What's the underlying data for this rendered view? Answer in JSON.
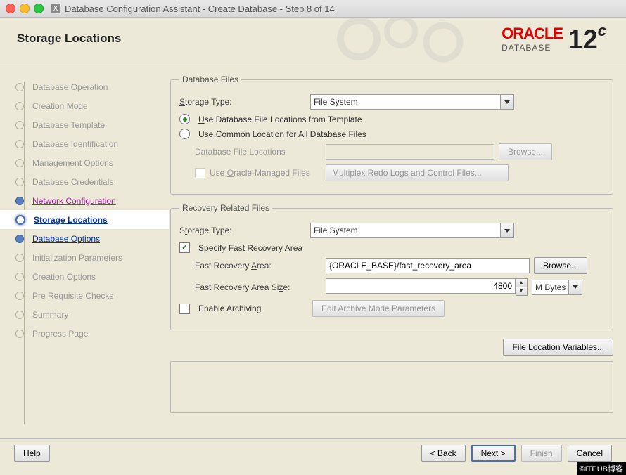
{
  "window": {
    "title": "Database Configuration Assistant - Create Database - Step 8 of 14"
  },
  "header": {
    "page_title": "Storage Locations",
    "brand_top": "ORACLE",
    "brand_sub": "DATABASE",
    "brand_ver": "12",
    "brand_c": "c"
  },
  "sidebar": {
    "items": [
      {
        "label": "Database Operation",
        "state": "done"
      },
      {
        "label": "Creation Mode",
        "state": "done"
      },
      {
        "label": "Database Template",
        "state": "done"
      },
      {
        "label": "Database Identification",
        "state": "done"
      },
      {
        "label": "Management Options",
        "state": "done"
      },
      {
        "label": "Database Credentials",
        "state": "done"
      },
      {
        "label": "Network Configuration",
        "state": "done_link"
      },
      {
        "label": "Storage Locations",
        "state": "current"
      },
      {
        "label": "Database Options",
        "state": "next"
      },
      {
        "label": "Initialization Parameters",
        "state": "todo"
      },
      {
        "label": "Creation Options",
        "state": "todo"
      },
      {
        "label": "Pre Requisite Checks",
        "state": "todo"
      },
      {
        "label": "Summary",
        "state": "todo"
      },
      {
        "label": "Progress Page",
        "state": "todo"
      }
    ]
  },
  "db_files": {
    "legend": "Database Files",
    "storage_type_label": "Storage Type:",
    "storage_type_value": "File System",
    "radio_template": "Use Database File Locations from Template",
    "radio_common": "Use Common Location for All Database Files",
    "loc_label": "Database File Locations",
    "loc_value": "",
    "browse": "Browse...",
    "omf_label": "Use Oracle-Managed Files",
    "multiplex": "Multiplex Redo Logs and Control Files..."
  },
  "recovery": {
    "legend": "Recovery Related Files",
    "storage_type_label": "Storage Type:",
    "storage_type_value": "File System",
    "specify_label": "Specify Fast Recovery Area",
    "fra_label": "Fast Recovery Area:",
    "fra_value": "{ORACLE_BASE}/fast_recovery_area",
    "browse": "Browse...",
    "size_label": "Fast Recovery Area Size:",
    "size_value": "4800",
    "size_unit": "M Bytes",
    "archive_label": "Enable Archiving",
    "archive_btn": "Edit Archive Mode Parameters"
  },
  "file_loc_vars": "File Location Variables...",
  "footer": {
    "help": "Help",
    "back": "< Back",
    "next": "Next >",
    "finish": "Finish",
    "cancel": "Cancel"
  },
  "watermark": "©ITPUB博客"
}
